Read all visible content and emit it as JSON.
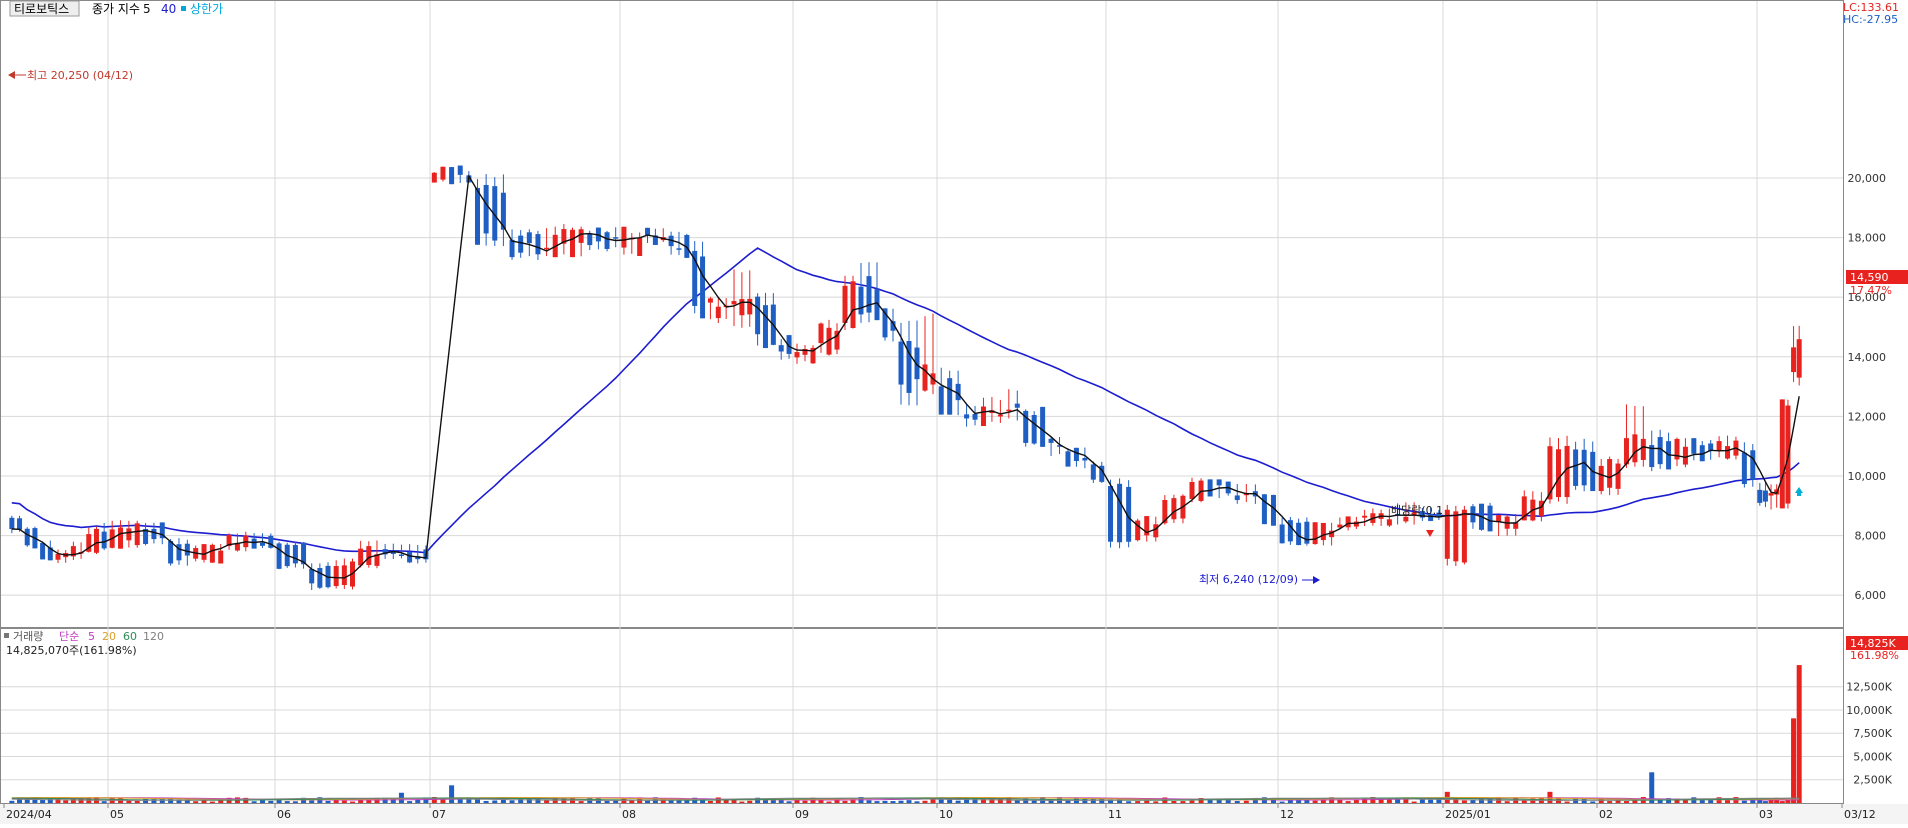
{
  "legend": {
    "price": {
      "stock_name": "티로보틱스",
      "indicator": "종가 지수",
      "ma_short": "5",
      "ma_long": "40",
      "limit_up": "상한가"
    },
    "volume": {
      "label": "거래량",
      "simple": "단순",
      "ma5": "5",
      "ma20": "20",
      "ma60": "60",
      "ma120": "120"
    }
  },
  "lc_label": "LC:133.61",
  "hc_label": "HC:-27.95",
  "annotations": {
    "high": "최고 20,250 (04/12)",
    "low": "최저 6,240 (12/09)",
    "dividend": "배당락(0.1"
  },
  "last_price_tag": "14,590",
  "last_change_tag": "17.47%",
  "volume_info": "14,825,070주(161.98%)",
  "volume_tag": "14,825K",
  "volume_pct_tag": "161.98%",
  "colors": {
    "up": "#e8231f",
    "down": "#1f5fc4",
    "ma5": "#111111",
    "ma40": "#1c1cd0",
    "grid": "#d8d8d8",
    "vol_ma5": "#c03cc0",
    "vol_ma20": "#d9a028",
    "vol_ma60": "#2e8b57",
    "vol_ma120": "#808080"
  },
  "chart_data": [
    {
      "type": "candlestick",
      "title": "티로보틱스",
      "x_tick_labels": [
        "2024/04",
        "05",
        "06",
        "07",
        "08",
        "09",
        "10",
        "11",
        "12",
        "2025/01",
        "02",
        "03",
        "03/12"
      ],
      "y_tick_labels": [
        "6,000",
        "8,000",
        "10,000",
        "12,000",
        "14,000",
        "16,000",
        "18,000",
        "20,000"
      ],
      "ylim": [
        5100,
        22600
      ],
      "grid": true,
      "last_close": 14590,
      "last_change_pct": 17.47,
      "high": {
        "value": 20250,
        "date": "04/12"
      },
      "low": {
        "value": 6240,
        "date": "12/09"
      },
      "ohlc_key": {
        "2024/04": [
          [
            20100,
            20250,
            19900,
            20050
          ],
          [
            19800,
            20050,
            17800,
            18100
          ],
          [
            17900,
            18300,
            17300,
            17500
          ],
          [
            17500,
            18400,
            17400,
            18200
          ],
          [
            18100,
            18300,
            17600,
            17700
          ]
        ],
        "05": [
          [
            17700,
            18200,
            17500,
            18100
          ],
          [
            18100,
            18300,
            17900,
            18000
          ],
          [
            18000,
            18200,
            17500,
            17600
          ],
          [
            17600,
            17800,
            15400,
            15600
          ],
          [
            15600,
            16000,
            15200,
            15800
          ],
          [
            15700,
            16900,
            15000,
            16100
          ],
          [
            16000,
            16200,
            14400,
            14500
          ],
          [
            14500,
            14600,
            13900,
            14000
          ]
        ],
        "06": [
          [
            14000,
            14400,
            13800,
            14300
          ],
          [
            14300,
            15200,
            14100,
            15000
          ],
          [
            15000,
            16800,
            14900,
            16500
          ],
          [
            16400,
            17100,
            15200,
            15300
          ],
          [
            15400,
            15600,
            14500,
            14700
          ],
          [
            14600,
            15200,
            12400,
            13000
          ],
          [
            13000,
            15400,
            12800,
            13500
          ]
        ],
        "07": [
          [
            13200,
            13600,
            12100,
            12300
          ],
          [
            12200,
            12400,
            11700,
            11900
          ],
          [
            11900,
            12600,
            11800,
            12300
          ],
          [
            12200,
            12900,
            11900,
            12100
          ],
          [
            12100,
            12200,
            11000,
            11200
          ],
          [
            11100,
            11300,
            10700,
            10900
          ],
          [
            10800,
            10900,
            10300,
            10400
          ],
          [
            10400,
            10500,
            9800,
            9900
          ]
        ],
        "08": [
          [
            9800,
            9900,
            7600,
            7900
          ],
          [
            7900,
            8600,
            7800,
            8500
          ],
          [
            8500,
            9400,
            8400,
            9200
          ],
          [
            9200,
            9900,
            9100,
            9700
          ],
          [
            9700,
            9800,
            9300,
            9500
          ],
          [
            9500,
            9700,
            9100,
            9300
          ],
          [
            9300,
            9400,
            8400,
            8500
          ]
        ],
        "09": [
          [
            8500,
            8600,
            7700,
            7800
          ],
          [
            7800,
            8400,
            7700,
            8300
          ],
          [
            8300,
            8600,
            8200,
            8500
          ],
          [
            8500,
            8900,
            8300,
            8600
          ],
          [
            8600,
            9100,
            8400,
            8700
          ],
          [
            8700,
            8900,
            8500,
            8600
          ]
        ],
        "10": [
          [
            8600,
            8700,
            8100,
            8200
          ],
          [
            8200,
            8300,
            7600,
            7700
          ],
          [
            7700,
            7800,
            7200,
            7300
          ],
          [
            7300,
            7500,
            7100,
            7400
          ],
          [
            7400,
            7800,
            7200,
            7500
          ],
          [
            7500,
            8300,
            7400,
            8100
          ],
          [
            8100,
            8400,
            7500,
            7600
          ]
        ],
        "11": [
          [
            7700,
            8500,
            7600,
            8300
          ],
          [
            8300,
            8400,
            7700,
            7800
          ],
          [
            7800,
            7900,
            7000,
            7200
          ],
          [
            7200,
            7700,
            7100,
            7600
          ],
          [
            7600,
            8100,
            7500,
            7900
          ],
          [
            7900,
            8100,
            7600,
            7700
          ]
        ],
        "12": [
          [
            7700,
            7800,
            6900,
            7000
          ],
          [
            7000,
            7100,
            6200,
            6300
          ],
          [
            6300,
            7200,
            6200,
            7000
          ],
          [
            7000,
            7800,
            6900,
            7500
          ],
          [
            7500,
            7700,
            7200,
            7400
          ],
          [
            7400,
            7700,
            7100,
            7200
          ]
        ],
        "2025/01": [
          [
            7100,
            9000,
            7000,
            8900
          ],
          [
            8900,
            9100,
            8200,
            8300
          ],
          [
            8300,
            8700,
            8000,
            8600
          ],
          [
            8600,
            9500,
            8500,
            9300
          ],
          [
            9300,
            11300,
            9100,
            10800
          ],
          [
            10800,
            11200,
            9500,
            9600
          ]
        ],
        "02": [
          [
            9600,
            10600,
            9400,
            10400
          ],
          [
            10400,
            12400,
            10300,
            11200
          ],
          [
            11200,
            11500,
            10200,
            10400
          ],
          [
            10400,
            11300,
            10300,
            11100
          ],
          [
            11100,
            11200,
            10500,
            10700
          ],
          [
            10700,
            11300,
            10600,
            11000
          ],
          [
            11000,
            11100,
            9600,
            9700
          ]
        ],
        "03": [
          [
            9700,
            9800,
            9000,
            9200
          ],
          [
            9200,
            9700,
            8900,
            9600
          ],
          [
            8900,
            12500,
            8900,
            12400
          ],
          [
            13300,
            15100,
            13100,
            14590
          ]
        ]
      },
      "ma_last": {
        "ma5": 11800,
        "ma40": 10150
      }
    },
    {
      "type": "bar",
      "title": "거래량",
      "y_tick_labels": [
        "2,500K",
        "5,000K",
        "7,500K",
        "10,000K",
        "12,500K"
      ],
      "ylim": [
        0,
        15800
      ],
      "last_volume_shares": 14825070,
      "last_volume_pct": 161.98,
      "notable_volumes_k": [
        {
          "x": "03/12",
          "value": 14825
        },
        {
          "x": "03/11",
          "value": 9100
        },
        {
          "x": "02 mid",
          "value": 3300
        },
        {
          "x": "06 late",
          "value": 1900
        }
      ]
    }
  ]
}
